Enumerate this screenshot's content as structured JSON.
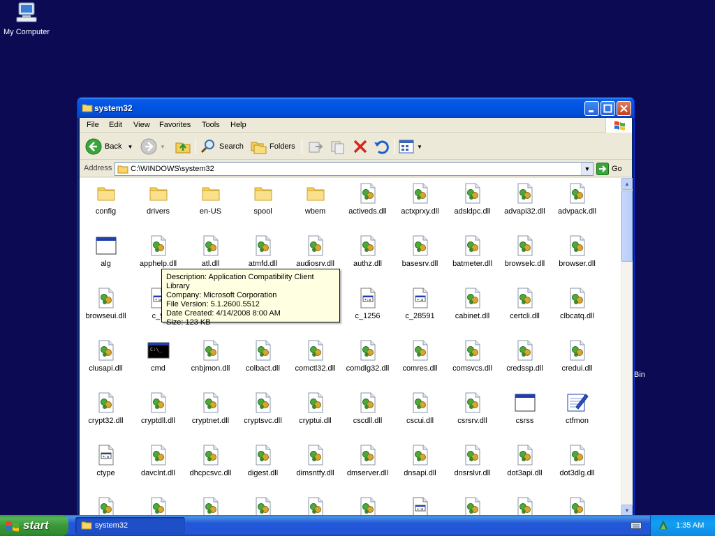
{
  "desktop": {
    "my_computer_label": "My Computer",
    "recycle_partial_label": "Bin"
  },
  "window": {
    "title": "system32",
    "menu": [
      "File",
      "Edit",
      "View",
      "Favorites",
      "Tools",
      "Help"
    ],
    "toolbar": {
      "back_label": "Back",
      "search_label": "Search",
      "folders_label": "Folders"
    },
    "address": {
      "label": "Address",
      "value": "C:\\WINDOWS\\system32",
      "go_label": "Go"
    }
  },
  "files": [
    {
      "name": "config",
      "icon": "folder-icon"
    },
    {
      "name": "drivers",
      "icon": "folder-icon"
    },
    {
      "name": "en-US",
      "icon": "folder-icon"
    },
    {
      "name": "spool",
      "icon": "folder-icon"
    },
    {
      "name": "wbem",
      "icon": "folder-icon"
    },
    {
      "name": "activeds.dll",
      "icon": "dll-icon"
    },
    {
      "name": "actxprxy.dll",
      "icon": "dll-icon"
    },
    {
      "name": "adsldpc.dll",
      "icon": "dll-icon"
    },
    {
      "name": "advapi32.dll",
      "icon": "dll-icon"
    },
    {
      "name": "advpack.dll",
      "icon": "dll-icon"
    },
    {
      "name": "alg",
      "icon": "exe-window-icon"
    },
    {
      "name": "apphelp.dll",
      "icon": "dll-icon"
    },
    {
      "name": "atl.dll",
      "icon": "dll-icon"
    },
    {
      "name": "atmfd.dll",
      "icon": "dll-icon"
    },
    {
      "name": "audiosrv.dll",
      "icon": "dll-icon"
    },
    {
      "name": "authz.dll",
      "icon": "dll-icon"
    },
    {
      "name": "basesrv.dll",
      "icon": "dll-icon"
    },
    {
      "name": "batmeter.dll",
      "icon": "dll-icon"
    },
    {
      "name": "browselc.dll",
      "icon": "dll-icon"
    },
    {
      "name": "browser.dll",
      "icon": "dll-icon"
    },
    {
      "name": "browseui.dll",
      "icon": "dll-icon"
    },
    {
      "name": "c_9",
      "icon": "nls-icon"
    },
    {
      "name": "",
      "icon": ""
    },
    {
      "name": "",
      "icon": ""
    },
    {
      "name": "",
      "icon": ""
    },
    {
      "name": "c_1256",
      "icon": "nls-icon"
    },
    {
      "name": "c_28591",
      "icon": "nls-icon"
    },
    {
      "name": "cabinet.dll",
      "icon": "dll-icon"
    },
    {
      "name": "certcli.dll",
      "icon": "dll-icon"
    },
    {
      "name": "clbcatq.dll",
      "icon": "dll-icon"
    },
    {
      "name": "clusapi.dll",
      "icon": "dll-icon"
    },
    {
      "name": "cmd",
      "icon": "cmd-icon"
    },
    {
      "name": "cnbjmon.dll",
      "icon": "dll-icon"
    },
    {
      "name": "colbact.dll",
      "icon": "dll-icon"
    },
    {
      "name": "comctl32.dll",
      "icon": "dll-icon"
    },
    {
      "name": "comdlg32.dll",
      "icon": "dll-icon"
    },
    {
      "name": "comres.dll",
      "icon": "dll-icon"
    },
    {
      "name": "comsvcs.dll",
      "icon": "dll-icon"
    },
    {
      "name": "credssp.dll",
      "icon": "dll-icon"
    },
    {
      "name": "credui.dll",
      "icon": "dll-icon"
    },
    {
      "name": "crypt32.dll",
      "icon": "dll-icon"
    },
    {
      "name": "cryptdll.dll",
      "icon": "dll-icon"
    },
    {
      "name": "cryptnet.dll",
      "icon": "dll-icon"
    },
    {
      "name": "cryptsvc.dll",
      "icon": "dll-icon"
    },
    {
      "name": "cryptui.dll",
      "icon": "dll-icon"
    },
    {
      "name": "cscdll.dll",
      "icon": "dll-icon"
    },
    {
      "name": "cscui.dll",
      "icon": "dll-icon"
    },
    {
      "name": "csrsrv.dll",
      "icon": "dll-icon"
    },
    {
      "name": "csrss",
      "icon": "exe-window-icon"
    },
    {
      "name": "ctfmon",
      "icon": "ctfmon-icon"
    },
    {
      "name": "ctype",
      "icon": "nls-icon"
    },
    {
      "name": "davclnt.dll",
      "icon": "dll-icon"
    },
    {
      "name": "dhcpcsvc.dll",
      "icon": "dll-icon"
    },
    {
      "name": "digest.dll",
      "icon": "dll-icon"
    },
    {
      "name": "dimsntfy.dll",
      "icon": "dll-icon"
    },
    {
      "name": "dmserver.dll",
      "icon": "dll-icon"
    },
    {
      "name": "dnsapi.dll",
      "icon": "dll-icon"
    },
    {
      "name": "dnsrslvr.dll",
      "icon": "dll-icon"
    },
    {
      "name": "dot3api.dll",
      "icon": "dll-icon"
    },
    {
      "name": "dot3dlg.dll",
      "icon": "dll-icon"
    },
    {
      "name": "",
      "icon": "dll-icon"
    },
    {
      "name": "",
      "icon": "dll-icon"
    },
    {
      "name": "",
      "icon": "dll-icon"
    },
    {
      "name": "",
      "icon": "dll-icon"
    },
    {
      "name": "",
      "icon": "dll-icon"
    },
    {
      "name": "",
      "icon": "dll-icon"
    },
    {
      "name": "",
      "icon": "nls-icon"
    },
    {
      "name": "",
      "icon": "dll-icon"
    },
    {
      "name": "",
      "icon": "dll-icon"
    },
    {
      "name": "",
      "icon": "dll-icon"
    }
  ],
  "tooltip": {
    "description": "Description: Application Compatibility Client Library",
    "company": "Company: Microsoft Corporation",
    "version": "File Version: 5.1.2600.5512",
    "date": "Date Created: 4/14/2008 8:00 AM",
    "size": "Size: 123 KB"
  },
  "taskbar": {
    "start_label": "start",
    "task_label": "system32",
    "clock": "1:35 AM"
  },
  "colors": {
    "desktop": "#0b0a52",
    "titlebar": "#0054e3",
    "start": "#3a9838",
    "tooltip": "#ffffe1"
  }
}
